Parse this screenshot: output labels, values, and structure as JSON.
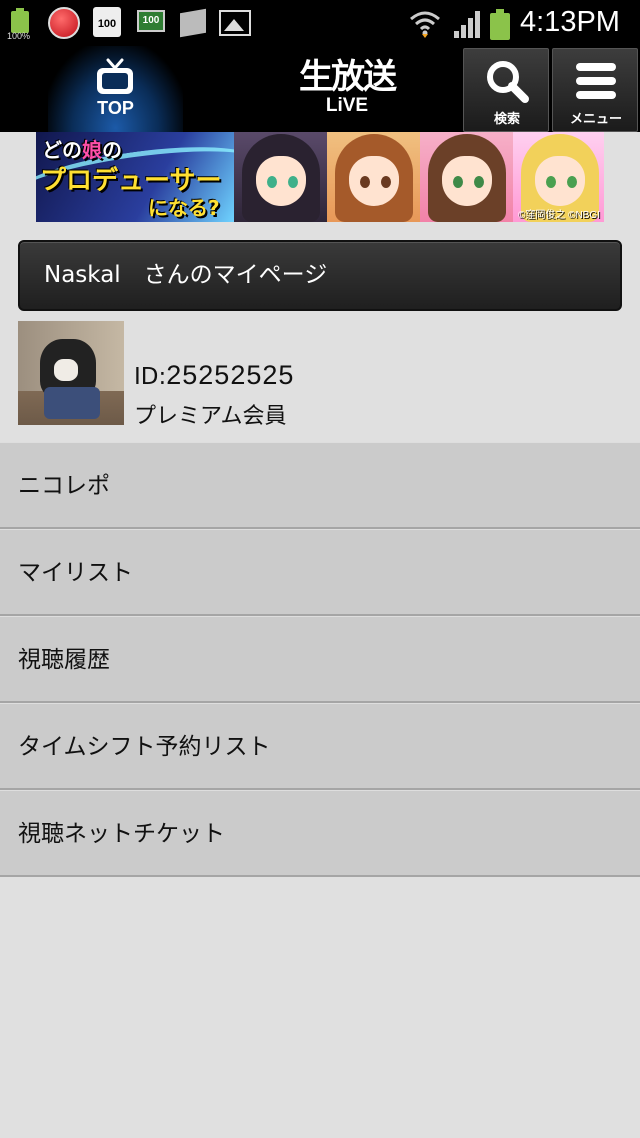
{
  "status_bar": {
    "battery_small_label": "100%",
    "calendar_value": "100",
    "app_badge_value": "100",
    "time": "4:13PM"
  },
  "header": {
    "top_label": "TOP",
    "logo_main": "生放送",
    "logo_sub": "LiVE",
    "search_label": "検索",
    "menu_label": "メニュー"
  },
  "banner": {
    "line1_a": "どの",
    "line1_b": "娘",
    "line1_c": "の",
    "line2": "プロデューサー",
    "line3": "になる?",
    "copyright": "©窪岡俊之 ©NBGI"
  },
  "page_title": "Naskal　さんのマイページ",
  "profile": {
    "id_label": "ID:",
    "id_value": "25252525",
    "membership": "プレミアム会員"
  },
  "menu_items": [
    {
      "label": "ニコレポ"
    },
    {
      "label": "マイリスト"
    },
    {
      "label": "視聴履歴"
    },
    {
      "label": "タイムシフト予約リスト"
    },
    {
      "label": "視聴ネットチケット"
    }
  ],
  "colors": {
    "header_bg": "#000000",
    "list_item_bg": "#cbcbcb",
    "page_bg": "#e0e0e0",
    "battery_green": "#8bc34a"
  }
}
